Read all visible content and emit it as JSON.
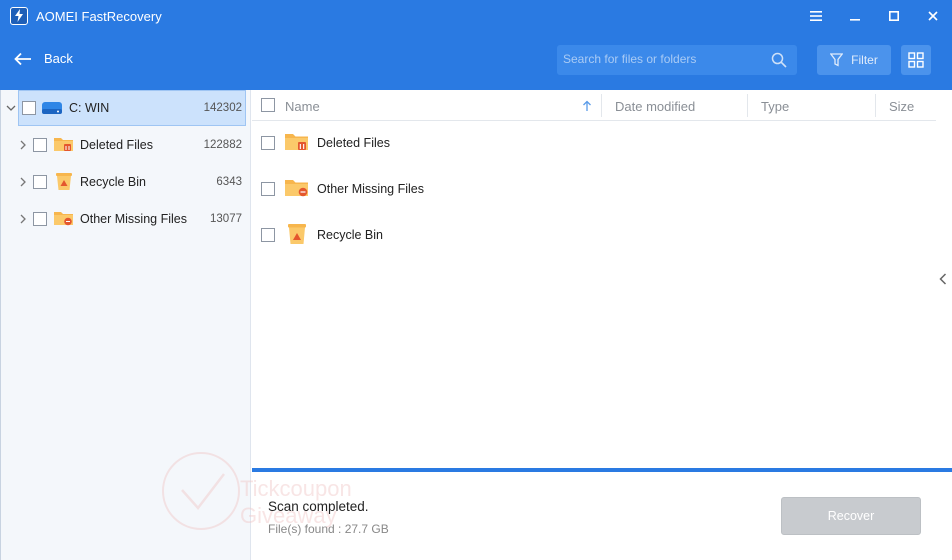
{
  "window": {
    "title": "AOMEI FastRecovery"
  },
  "toolbar": {
    "back_label": "Back",
    "search_placeholder": "Search for files or folders",
    "filter_label": "Filter"
  },
  "tree": {
    "root": {
      "label": "C: WIN",
      "count": "142302"
    },
    "items": [
      {
        "label": "Deleted Files",
        "count": "122882"
      },
      {
        "label": "Recycle Bin",
        "count": "6343"
      },
      {
        "label": "Other Missing Files",
        "count": "13077"
      }
    ]
  },
  "table": {
    "columns": [
      "Name",
      "Date modified",
      "Type",
      "Size"
    ],
    "rows": [
      {
        "name": "Deleted Files"
      },
      {
        "name": "Other Missing Files"
      },
      {
        "name": "Recycle Bin"
      }
    ]
  },
  "status": {
    "message": "Scan completed.",
    "files_found": "File(s) found : 27.7 GB",
    "recover_label": "Recover"
  },
  "watermark": {
    "line1": "Tickcoupon",
    "line2": "Giveaway"
  },
  "colors": {
    "accent": "#2a7ae2",
    "selection": "#cce2fc",
    "folder": "#f7b64d",
    "disabled_button": "#c8cbcf"
  }
}
